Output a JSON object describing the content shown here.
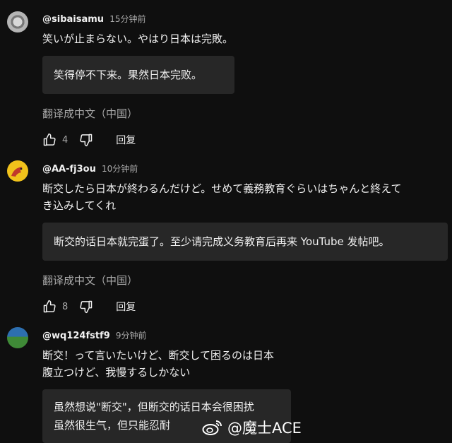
{
  "comments": [
    {
      "author": "@sibaisamu",
      "time": "15分钟前",
      "text_lines": [
        "笑いが止まらない。やはり日本は完敗。"
      ],
      "translation_lines": [
        "笑得停不下来。果然日本完败。"
      ],
      "translate_link": "翻译成中文（中国）",
      "likes": "4",
      "reply": "回复"
    },
    {
      "author": "@AA-fj3ou",
      "time": "10分钟前",
      "text_lines": [
        "断交したら日本が終わるんだけど。せめて義務教育ぐらいはちゃんと終えて",
        "き込みしてくれ"
      ],
      "translation_lines": [
        "断交的话日本就完蛋了。至少请完成义务教育后再来 YouTube 发帖吧。"
      ],
      "translate_link": "翻译成中文（中国）",
      "likes": "8",
      "reply": "回复"
    },
    {
      "author": "@wq124fstf9",
      "time": "9分钟前",
      "text_lines": [
        "断交！って言いたいけど、断交して困るのは日本",
        "腹立つけど、我慢するしかない"
      ],
      "translation_lines": [
        "虽然想说\"断交\"，但断交的话日本会很困扰",
        "虽然很生气，但只能忍耐"
      ]
    }
  ],
  "watermark": "@魔士ACE",
  "icons": {
    "like": "thumbs-up-icon",
    "dislike": "thumbs-down-icon",
    "weibo": "weibo-logo-icon"
  }
}
